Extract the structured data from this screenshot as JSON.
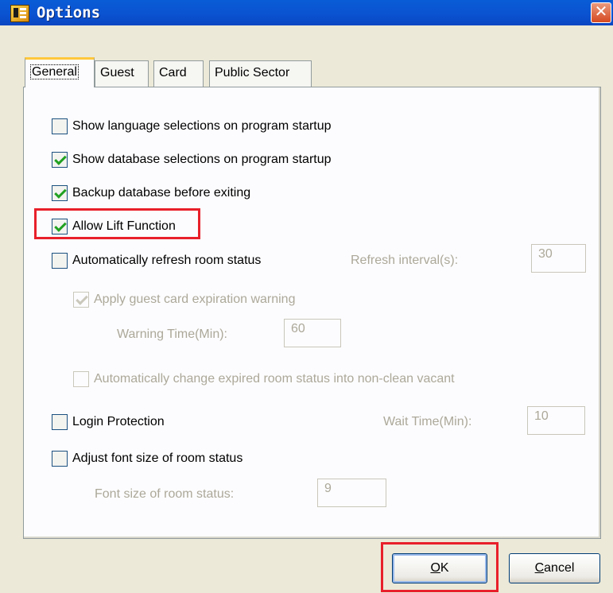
{
  "window": {
    "title": "Options",
    "close_glyph": "✕",
    "app_icon": "app-icon"
  },
  "tabs": [
    {
      "label": "General",
      "active": true
    },
    {
      "label": "Guest",
      "active": false
    },
    {
      "label": "Card",
      "active": false
    },
    {
      "label": "Public Sector",
      "active": false
    }
  ],
  "general": {
    "show_language": {
      "label": "Show language selections on program startup",
      "checked": false
    },
    "show_database": {
      "label": "Show database selections on program startup",
      "checked": true
    },
    "backup_database": {
      "label": "Backup database before exiting",
      "checked": true
    },
    "allow_lift": {
      "label": "Allow Lift Function",
      "checked": true,
      "highlighted": true
    },
    "auto_refresh": {
      "label": "Automatically refresh room status",
      "checked": false
    },
    "refresh_interval": {
      "label": "Refresh interval(s):",
      "value": "30"
    },
    "apply_expiration_warning": {
      "label": "Apply guest card expiration warning",
      "checked": true,
      "disabled": true
    },
    "warning_time": {
      "label": "Warning Time(Min):",
      "value": "60"
    },
    "auto_change_expired": {
      "label": "Automatically change expired room status into non-clean vacant",
      "checked": false,
      "disabled": true
    },
    "login_protection": {
      "label": "Login Protection",
      "checked": false
    },
    "wait_time": {
      "label": "Wait Time(Min):",
      "value": "10"
    },
    "adjust_font": {
      "label": "Adjust font size of room status",
      "checked": false
    },
    "font_size": {
      "label": "Font size of room status:",
      "value": "9"
    }
  },
  "buttons": {
    "ok": {
      "mnemonic": "O",
      "rest": "K",
      "highlighted": true
    },
    "cancel": {
      "mnemonic": "C",
      "rest": "ancel"
    }
  },
  "colors": {
    "titlebar": "#0a53d1",
    "highlight": "#e8202a",
    "check": "#21a121",
    "disabled_text": "#aca899"
  }
}
